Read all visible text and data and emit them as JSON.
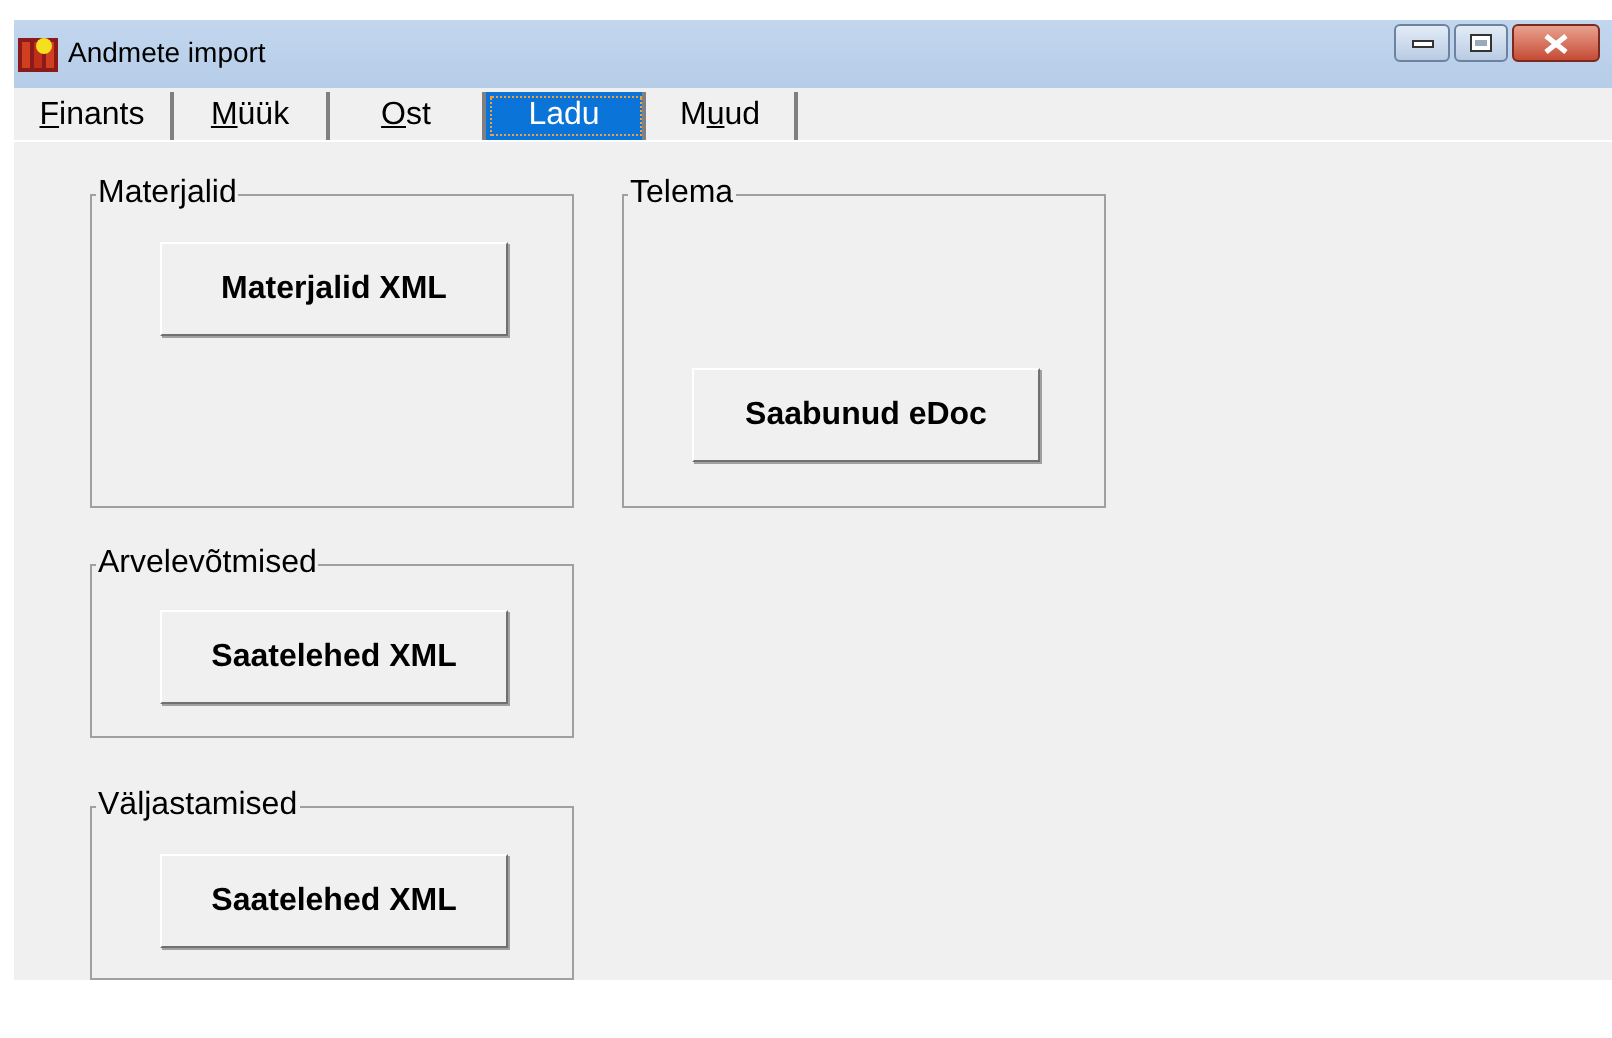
{
  "window": {
    "title": "Andmete import"
  },
  "tabs": [
    {
      "key": "F",
      "after": "inants",
      "selected": false
    },
    {
      "key": "M",
      "after": "üük",
      "selected": false
    },
    {
      "key": "O",
      "after": "st",
      "selected": false
    },
    {
      "after": "Ladu",
      "selected": true
    },
    {
      "before": "M",
      "key": "u",
      "after": "ud",
      "selected": false
    }
  ],
  "groups": [
    {
      "title": "Materjalid",
      "button": "Materjalid XML"
    },
    {
      "title": "Telema",
      "button": "Saabunud eDoc"
    },
    {
      "title": "Arvelevõtmised",
      "button": "Saatelehed XML"
    },
    {
      "title": "Väljastamised",
      "button": "Saatelehed XML"
    }
  ]
}
